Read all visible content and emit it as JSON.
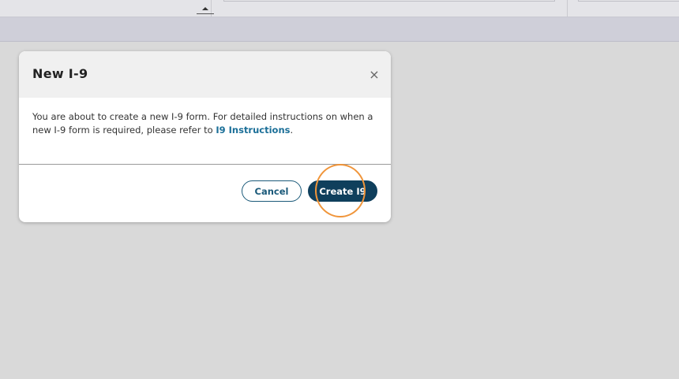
{
  "dialog": {
    "title": "New I-9",
    "close_icon": "×",
    "message_text": "You are about to create a new I-9 form. For detailed instructions on when a new I-9 form is required, please refer to ",
    "link_text": "I9 Instructions",
    "message_end": ".",
    "cancel_label": "Cancel",
    "create_label": "Create I9"
  },
  "colors": {
    "primary_button": "#0f3f5c",
    "link": "#1b6f98",
    "highlight": "#f0953a",
    "backdrop": "#d9d9d9"
  },
  "icons": {
    "close": "close-icon",
    "sort": "sort-ascending-icon"
  }
}
